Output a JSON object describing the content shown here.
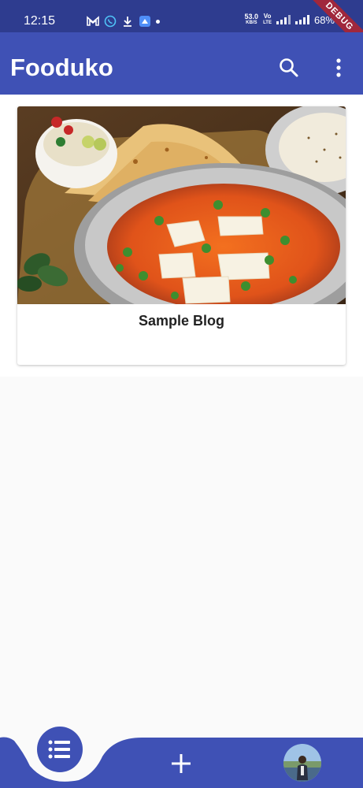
{
  "status_bar": {
    "time": "12:15",
    "net_speed_value": "53.0",
    "net_speed_unit": "KB/S",
    "volte_top": "Vo",
    "volte_bottom": "LTE",
    "battery": "68%",
    "debug_banner": "DEBUG"
  },
  "app_bar": {
    "title": "Fooduko",
    "search_icon": "search-icon",
    "menu_icon": "more-vert-icon"
  },
  "posts": [
    {
      "title": "Sample Blog",
      "image": "paneer-curry-food-photo"
    }
  ],
  "bottom_nav": {
    "items": [
      {
        "icon": "list-icon",
        "active": true
      },
      {
        "icon": "add-icon",
        "active": false
      },
      {
        "icon": "profile-avatar",
        "active": false
      }
    ]
  },
  "colors": {
    "primary": "#3f51b5",
    "status_bar": "#2e3c8f",
    "background": "#fafafa",
    "debug": "#a0273c"
  }
}
